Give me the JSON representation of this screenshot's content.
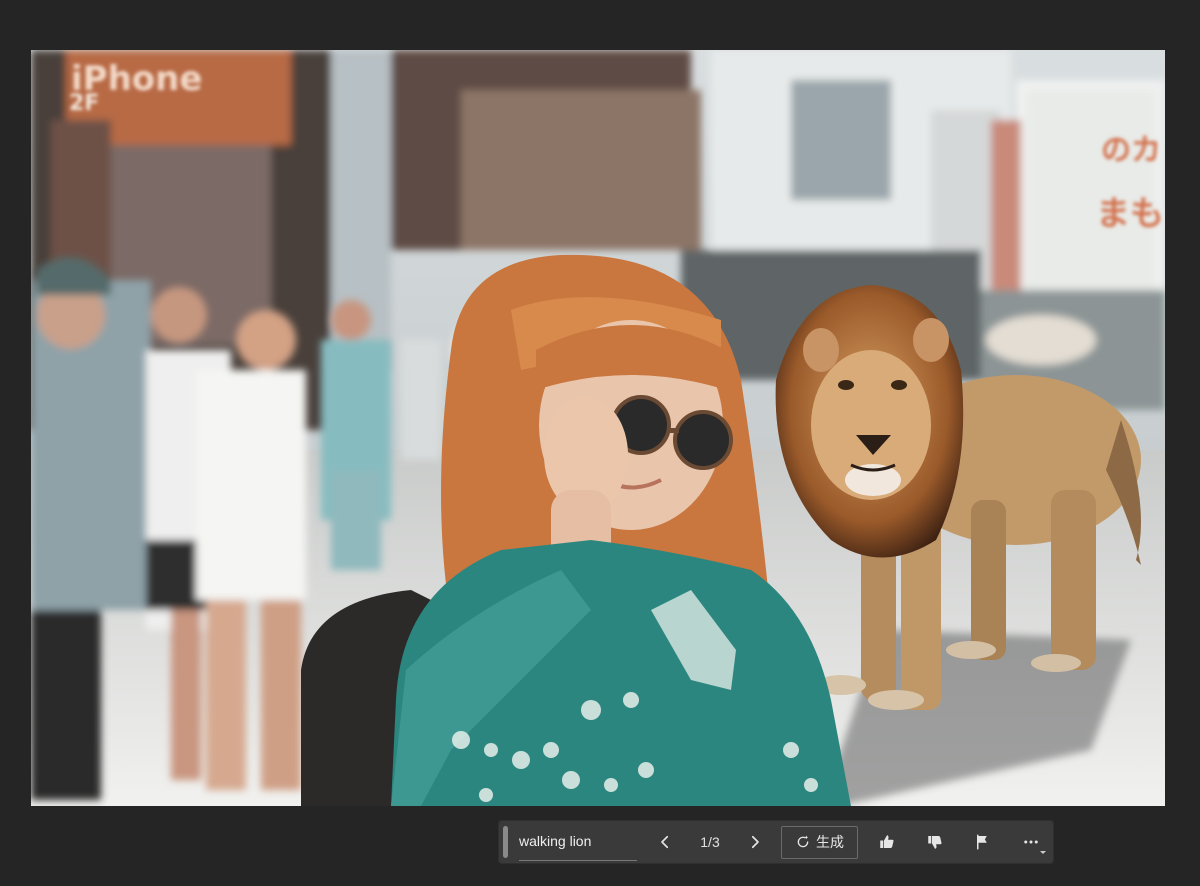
{
  "toolbar": {
    "prompt_text": "walking lion",
    "page_counter": "1/3",
    "generate_label": "生成",
    "prev_icon": "chevron-left-icon",
    "next_icon": "chevron-right-icon",
    "generate_icon": "regenerate-sparkle-icon",
    "like_icon": "thumbs-up-icon",
    "dislike_icon": "thumbs-down-icon",
    "flag_icon": "flag-icon",
    "more_icon": "more-dots-icon"
  },
  "image": {
    "sign_top_left": "iPhone",
    "sign_floor": "2F",
    "sign_right": "のカ",
    "sign_right_2": "まも"
  },
  "colors": {
    "background": "#252525",
    "toolbar": "#3a3a3a",
    "hair": "#c9773f",
    "blouse": "#2c8680",
    "lion": "#c29a6a"
  }
}
